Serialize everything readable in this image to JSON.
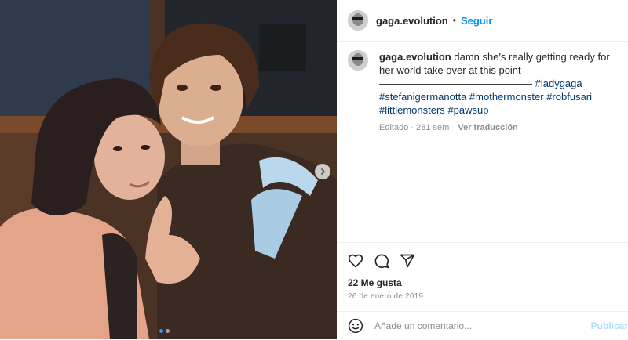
{
  "post": {
    "image_alt": "Photo of a woman and a man posing together",
    "carousel_dots": 2,
    "carousel_active": 0
  },
  "header": {
    "username": "gaga.evolution",
    "bullet": "•",
    "follow_label": "Seguir"
  },
  "caption": {
    "username": "gaga.evolution",
    "text": "damn she's really getting ready for her world take over at this point",
    "separator": "———————————————",
    "hashtags": [
      "#ladygaga",
      "#stefanigermanotta",
      "#mothermonster",
      "#robfusari",
      "#littlemonsters",
      "#pawsup"
    ],
    "edited_label": "Editado · 281 sem",
    "translate_label": "Ver traducción"
  },
  "actions": {
    "like_icon": "heart-icon",
    "comment_icon": "comment-icon",
    "share_icon": "send-icon"
  },
  "likes_label": "22 Me gusta",
  "date_label": "26 de enero de 2019",
  "comment": {
    "placeholder": "Añade un comentario...",
    "post_label": "Publicar"
  },
  "colors": {
    "accent": "#0095f6",
    "hashtag": "#00376b",
    "muted": "#8e8e8e"
  }
}
